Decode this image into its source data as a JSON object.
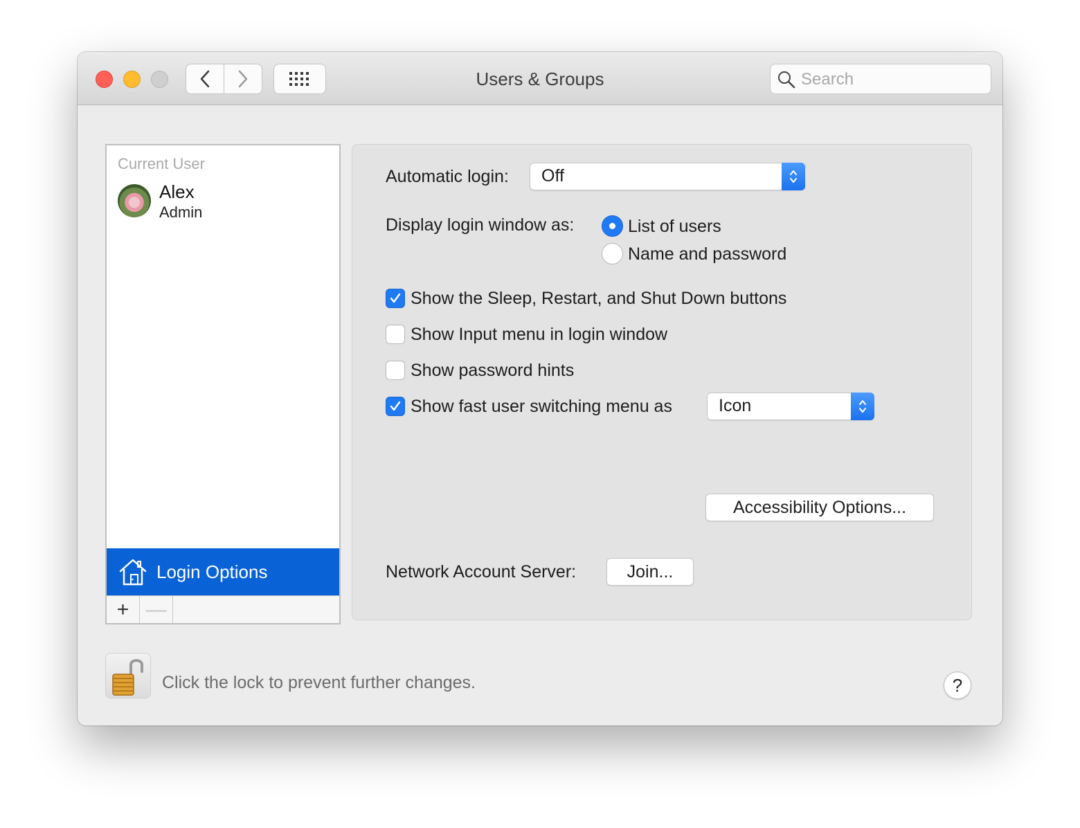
{
  "window": {
    "title": "Users & Groups"
  },
  "search": {
    "placeholder": "Search",
    "value": ""
  },
  "sidebar": {
    "section_label": "Current User",
    "user": {
      "name": "Alex",
      "role": "Admin"
    },
    "login_options_label": "Login Options",
    "add_label": "+",
    "remove_label": "—"
  },
  "panel": {
    "automatic_login": {
      "label": "Automatic login:",
      "value": "Off"
    },
    "display_login": {
      "label": "Display login window as:",
      "options": [
        {
          "label": "List of users",
          "selected": true
        },
        {
          "label": "Name and password",
          "selected": false
        }
      ]
    },
    "checkboxes": [
      {
        "label": "Show the Sleep, Restart, and Shut Down buttons",
        "checked": true
      },
      {
        "label": "Show Input menu in login window",
        "checked": false
      },
      {
        "label": "Show password hints",
        "checked": false
      },
      {
        "label": "Show fast user switching menu as",
        "checked": true
      }
    ],
    "fast_switch_value": "Icon",
    "accessibility_button": "Accessibility Options...",
    "network": {
      "label": "Network Account Server:",
      "button": "Join..."
    }
  },
  "footer": {
    "lock_text": "Click the lock to prevent further changes.",
    "help_label": "?"
  },
  "colors": {
    "accent": "#0a62d7",
    "close": "#fe5f57",
    "minimize": "#febc2e",
    "zoom_disabled": "#cfcfcf"
  }
}
